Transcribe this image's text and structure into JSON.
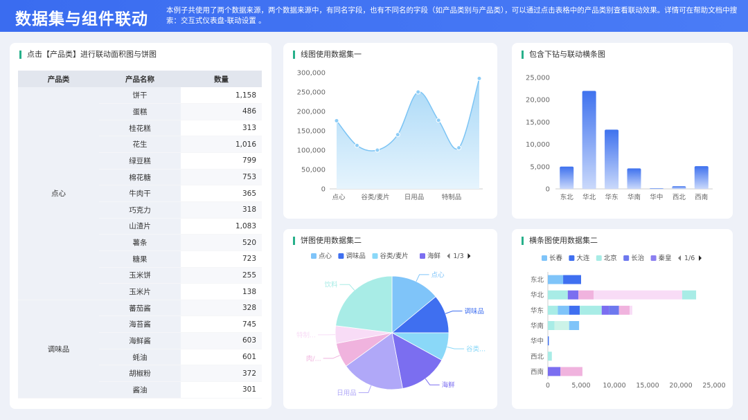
{
  "header": {
    "title": "数据集与组件联动",
    "description": "本例子共使用了两个数据来源，两个数据来源中，有同名字段，也有不同名的字段（如产品类别与产品类），可以通过点击表格中的产品类别查看联动效果。详情可在帮助文档中搜索：交互式仪表盘-联动设置 。"
  },
  "table_panel": {
    "title": "点击【产品类】进行联动面积图与饼图",
    "columns": [
      "产品类",
      "产品名称",
      "数量"
    ],
    "groups": [
      {
        "category": "点心",
        "rows": [
          [
            "饼干",
            "1,158"
          ],
          [
            "蛋糕",
            "486"
          ],
          [
            "桂花糕",
            "313"
          ],
          [
            "花生",
            "1,016"
          ],
          [
            "绿豆糕",
            "799"
          ],
          [
            "棉花糖",
            "753"
          ],
          [
            "牛肉干",
            "365"
          ],
          [
            "巧克力",
            "318"
          ],
          [
            "山渣片",
            "1,083"
          ],
          [
            "薯条",
            "520"
          ],
          [
            "糖果",
            "723"
          ],
          [
            "玉米饼",
            "255"
          ],
          [
            "玉米片",
            "138"
          ]
        ]
      },
      {
        "category": "调味品",
        "rows": [
          [
            "蕃茄酱",
            "328"
          ],
          [
            "海苔酱",
            "745"
          ],
          [
            "海鲜酱",
            "603"
          ],
          [
            "蚝油",
            "601"
          ],
          [
            "胡椒粉",
            "372"
          ],
          [
            "酱油",
            "301"
          ]
        ]
      }
    ]
  },
  "line_panel": {
    "title": "线图使用数据集一"
  },
  "bar_panel": {
    "title": "包含下钻与联动横条图"
  },
  "pie_panel": {
    "title": "饼图使用数据集二"
  },
  "hbar_panel": {
    "title": "横条图使用数据集二"
  },
  "chart_data": [
    {
      "type": "area",
      "title": "线图使用数据集一",
      "x_tick_labels": [
        "点心",
        "谷类/麦片",
        "日用品",
        "特制品"
      ],
      "values": [
        176000,
        112000,
        100000,
        140000,
        250000,
        177000,
        106000,
        285000
      ],
      "ylim": [
        0,
        300000
      ],
      "yticks": [
        "0",
        "50,000",
        "100,000",
        "150,000",
        "200,000",
        "250,000",
        "300,000"
      ],
      "colors": {
        "line": "#7cc4f4",
        "fill_top": "#a8d8f7",
        "fill_bottom": "#e6f4fd"
      }
    },
    {
      "type": "bar",
      "title": "包含下钻与联动横条图",
      "categories": [
        "东北",
        "华北",
        "华东",
        "华南",
        "华中",
        "西北",
        "西南"
      ],
      "values": [
        5000,
        22000,
        13300,
        4600,
        150,
        600,
        5100
      ],
      "ylim": [
        0,
        25000
      ],
      "yticks": [
        "0",
        "5,000",
        "10,000",
        "15,000",
        "20,000",
        "25,000"
      ],
      "colors": {
        "top": "#3f72ee",
        "bottom": "#cad9fb"
      }
    },
    {
      "type": "pie",
      "title": "饼图使用数据集二",
      "legend": {
        "items": [
          {
            "name": "点心",
            "color": "#7fc4f9"
          },
          {
            "name": "调味品",
            "color": "#3f6ff0"
          },
          {
            "name": "谷类/麦片",
            "color": "#8ad8f8"
          },
          {
            "name": "海鲜",
            "color": "#7b6ef0"
          }
        ],
        "page": "1/3",
        "placement": "top"
      },
      "slices": [
        {
          "label": "点心",
          "value": 14,
          "color": "#7fc4f9"
        },
        {
          "label": "调味品",
          "value": 11,
          "color": "#3f6ff0"
        },
        {
          "label": "谷类...",
          "value": 8,
          "color": "#8ad8f8"
        },
        {
          "label": "海鲜",
          "value": 14,
          "color": "#7b6ef0"
        },
        {
          "label": "日用品",
          "value": 18,
          "color": "#b0a8f8"
        },
        {
          "label": "肉/...",
          "value": 7,
          "color": "#f0b3de"
        },
        {
          "label": "特制...",
          "value": 5,
          "color": "#f8dcf6"
        },
        {
          "label": "饮料",
          "value": 23,
          "color": "#a8ece6"
        }
      ]
    },
    {
      "type": "bar",
      "orientation": "horizontal",
      "stacked": true,
      "title": "横条图使用数据集二",
      "legend": {
        "items": [
          {
            "name": "长春",
            "color": "#7fc4f9"
          },
          {
            "name": "大连",
            "color": "#3f6ff0"
          },
          {
            "name": "北京",
            "color": "#a8ece6"
          },
          {
            "name": "长治",
            "color": "#6d78ee"
          },
          {
            "name": "秦皇",
            "color": "#8b7ff0"
          }
        ],
        "page": "1/6",
        "placement": "top"
      },
      "categories": [
        "东北",
        "华北",
        "华东",
        "华南",
        "华中",
        "西北",
        "西南"
      ],
      "xlim": [
        0,
        25000
      ],
      "xticks": [
        "0",
        "5,000",
        "10,000",
        "15,000",
        "20,000",
        "25,000"
      ],
      "stacks": [
        [
          {
            "v": 2300,
            "c": "#7fc4f9"
          },
          {
            "v": 2700,
            "c": "#3f6ff0"
          }
        ],
        [
          {
            "v": 3000,
            "c": "#a8ece6"
          },
          {
            "v": 1600,
            "c": "#7b6ef0"
          },
          {
            "v": 2300,
            "c": "#f0b3de"
          },
          {
            "v": 13300,
            "c": "#f8dcf6"
          },
          {
            "v": 2100,
            "c": "#a8ece6"
          }
        ],
        [
          {
            "v": 1500,
            "c": "#a8ece6"
          },
          {
            "v": 1700,
            "c": "#7fc4f9"
          },
          {
            "v": 1600,
            "c": "#3f6ff0"
          },
          {
            "v": 3300,
            "c": "#a8ece6"
          },
          {
            "v": 1100,
            "c": "#7b6ef0"
          },
          {
            "v": 1500,
            "c": "#6d78ee"
          },
          {
            "v": 1600,
            "c": "#f0b3de"
          },
          {
            "v": 400,
            "c": "#f8dcf6"
          }
        ],
        [
          {
            "v": 1000,
            "c": "#a8ece6"
          },
          {
            "v": 2200,
            "c": "#ccf3e8"
          },
          {
            "v": 1500,
            "c": "#7fc4f9"
          }
        ],
        [
          {
            "v": 150,
            "c": "#3f6ff0"
          }
        ],
        [
          {
            "v": 600,
            "c": "#a8ece6"
          }
        ],
        [
          {
            "v": 1900,
            "c": "#7b6ef0"
          },
          {
            "v": 3300,
            "c": "#f0b3de"
          }
        ]
      ]
    }
  ]
}
